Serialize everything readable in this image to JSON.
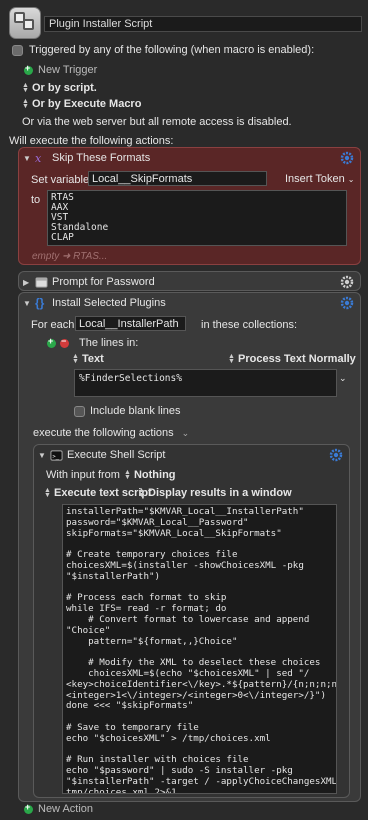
{
  "macro": {
    "title": "Plugin Installer Script"
  },
  "triggers": {
    "header": "Triggered by any of the following (when macro is enabled):",
    "new_trigger": "New Trigger",
    "by_script": "Or by script.",
    "by_execute_macro": "Or by Execute Macro",
    "web_server": "Or via the web server but all remote access is disabled."
  },
  "actions_header": "Will execute the following actions:",
  "skip_formats": {
    "title": "Skip These Formats",
    "set_variable_label": "Set variable",
    "variable_name": "Local__SkipFormats",
    "insert_token": "Insert Token",
    "to_label": "to",
    "value_lines": [
      "RTAS",
      "AAX",
      "VST",
      "Standalone",
      "CLAP"
    ],
    "preview": "empty ➜ RTAS..."
  },
  "prompt_password": {
    "title": "Prompt for Password"
  },
  "install_plugins": {
    "title": "Install Selected Plugins",
    "for_each_label": "For each",
    "variable_name": "Local__InstallerPath",
    "collections_label": "in these collections:",
    "lines_in_label": "The lines in:",
    "text_option": "Text",
    "process_option": "Process Text Normally",
    "source_text": "%FinderSelections%",
    "include_blank": "Include blank lines",
    "execute_label": "execute the following actions"
  },
  "shell_script": {
    "title": "Execute Shell Script",
    "input_from_label": "With input from",
    "input_from_value": "Nothing",
    "execute_mode": "Execute text script",
    "display_mode": "Display results in a window",
    "code_lines": [
      "installerPath=\"$KMVAR_Local__InstallerPath\"",
      "password=\"$KMVAR_Local__Password\"",
      "skipFormats=\"$KMVAR_Local__SkipFormats\"",
      "",
      "# Create temporary choices file",
      "choicesXML=$(installer -showChoicesXML -pkg",
      "\"$installerPath\")",
      "",
      "# Process each format to skip",
      "while IFS= read -r format; do",
      "    # Convert format to lowercase and append",
      "\"Choice\"",
      "    pattern=\"${format,,}Choice\"",
      "",
      "    # Modify the XML to deselect these choices",
      "    choicesXML=$(echo \"$choicesXML\" | sed \"/",
      "<key>choiceIdentifier<\\/key>.*${pattern}/{n;n;n;n;s/",
      "<integer>1<\\/integer>/<integer>0<\\/integer>/}\")",
      "done <<< \"$skipFormats\"",
      "",
      "# Save to temporary file",
      "echo \"$choicesXML\" > /tmp/choices.xml",
      "",
      "# Run installer with choices file",
      "echo \"$password\" | sudo -S installer -pkg",
      "\"$installerPath\" -target / -applyChoiceChangesXML /",
      "tmp/choices.xml 2>&1",
      "",
      "# Cl..."
    ]
  },
  "new_action": "New Action",
  "colors": {
    "accent_green": "#2aa84a",
    "accent_red": "#d23b3b",
    "gear_blue": "#3a7bd5",
    "red_panel": "#5a2626"
  }
}
